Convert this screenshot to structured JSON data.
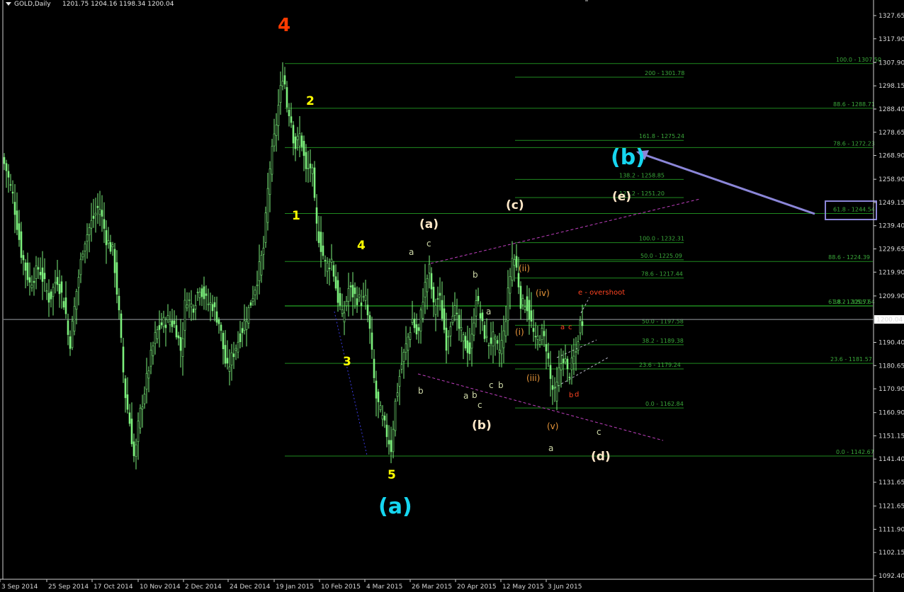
{
  "chart_data": {
    "type": "candlestick",
    "symbol_label": "GOLD,Daily",
    "ohlc_label": "1201.75 1204.16 1198.34 1200.04",
    "current_price": "1200.04",
    "y_range": [
      1092.65,
      1332.6
    ],
    "y_ticks": [
      "1327.65",
      "1317.90",
      "1307.90",
      "1298.15",
      "1288.40",
      "1278.65",
      "1268.90",
      "1258.90",
      "1249.15",
      "1239.40",
      "1229.65",
      "1219.90",
      "1209.90",
      "1190.40",
      "1180.65",
      "1170.90",
      "1160.90",
      "1151.15",
      "1141.40",
      "1131.65",
      "1121.65",
      "1111.90",
      "1102.15",
      "1092.40"
    ],
    "x_labels": [
      "3 Sep 2014",
      "25 Sep 2014",
      "17 Oct 2014",
      "10 Nov 2014",
      "2 Dec 2014",
      "24 Dec 2014",
      "19 Jan 2015",
      "10 Feb 2015",
      "4 Mar 2015",
      "26 Mar 2015",
      "20 Apr 2015",
      "12 May 2015",
      "3 Jun 2015"
    ],
    "price_path": [
      [
        0,
        1270
      ],
      [
        8,
        1264
      ],
      [
        18,
        1252
      ],
      [
        30,
        1228
      ],
      [
        42,
        1215
      ],
      [
        55,
        1222
      ],
      [
        70,
        1208
      ],
      [
        80,
        1218
      ],
      [
        92,
        1205
      ],
      [
        98,
        1188
      ],
      [
        108,
        1212
      ],
      [
        118,
        1232
      ],
      [
        128,
        1240
      ],
      [
        140,
        1248
      ],
      [
        150,
        1234
      ],
      [
        160,
        1228
      ],
      [
        168,
        1202
      ],
      [
        176,
        1170
      ],
      [
        184,
        1155
      ],
      [
        190,
        1140
      ],
      [
        196,
        1158
      ],
      [
        204,
        1170
      ],
      [
        212,
        1183
      ],
      [
        220,
        1194
      ],
      [
        228,
        1198
      ],
      [
        238,
        1200
      ],
      [
        248,
        1197
      ],
      [
        256,
        1186
      ],
      [
        262,
        1210
      ],
      [
        272,
        1205
      ],
      [
        282,
        1214
      ],
      [
        292,
        1207
      ],
      [
        300,
        1206
      ],
      [
        310,
        1198
      ],
      [
        320,
        1178
      ],
      [
        332,
        1188
      ],
      [
        342,
        1196
      ],
      [
        352,
        1205
      ],
      [
        362,
        1216
      ],
      [
        372,
        1230
      ],
      [
        380,
        1262
      ],
      [
        388,
        1278
      ],
      [
        394,
        1292
      ],
      [
        400,
        1305
      ],
      [
        405,
        1290
      ],
      [
        410,
        1286
      ],
      [
        416,
        1272
      ],
      [
        424,
        1278
      ],
      [
        432,
        1262
      ],
      [
        440,
        1265
      ],
      [
        446,
        1240
      ],
      [
        452,
        1232
      ],
      [
        460,
        1222
      ],
      [
        468,
        1225
      ],
      [
        476,
        1210
      ],
      [
        484,
        1200
      ],
      [
        492,
        1213
      ],
      [
        500,
        1210
      ],
      [
        508,
        1208
      ],
      [
        516,
        1208
      ],
      [
        522,
        1195
      ],
      [
        530,
        1168
      ],
      [
        538,
        1160
      ],
      [
        546,
        1152
      ],
      [
        552,
        1146
      ],
      [
        558,
        1165
      ],
      [
        566,
        1180
      ],
      [
        574,
        1190
      ],
      [
        582,
        1200
      ],
      [
        590,
        1192
      ],
      [
        598,
        1212
      ],
      [
        606,
        1221
      ],
      [
        612,
        1205
      ],
      [
        620,
        1210
      ],
      [
        630,
        1190
      ],
      [
        640,
        1206
      ],
      [
        648,
        1196
      ],
      [
        656,
        1190
      ],
      [
        664,
        1186
      ],
      [
        672,
        1210
      ],
      [
        680,
        1198
      ],
      [
        688,
        1190
      ],
      [
        696,
        1192
      ],
      [
        704,
        1186
      ],
      [
        712,
        1195
      ],
      [
        718,
        1214
      ],
      [
        724,
        1228
      ],
      [
        730,
        1220
      ],
      [
        736,
        1205
      ],
      [
        742,
        1208
      ],
      [
        750,
        1198
      ],
      [
        756,
        1190
      ],
      [
        764,
        1195
      ],
      [
        772,
        1188
      ],
      [
        778,
        1172
      ],
      [
        784,
        1168
      ],
      [
        790,
        1180
      ],
      [
        796,
        1185
      ],
      [
        802,
        1176
      ],
      [
        808,
        1182
      ],
      [
        814,
        1187
      ],
      [
        818,
        1198
      ],
      [
        822,
        1200
      ]
    ],
    "horizontal_levels": [
      {
        "label": "100.0 - 1307.50",
        "value": 1307.5
      },
      {
        "label": "200 - 1301.78",
        "value": 1301.78
      },
      {
        "label": "88.6 - 1288.71",
        "value": 1288.71
      },
      {
        "label": "161.8 - 1275.24",
        "value": 1275.24
      },
      {
        "label": "78.6 - 1272.23",
        "value": 1272.23
      },
      {
        "label": "138.2 - 1258.85",
        "value": 1258.85
      },
      {
        "label": "127.2 - 1251.20",
        "value": 1251.2
      },
      {
        "label": "61.8 - 1244.54",
        "value": 1244.54
      },
      {
        "label": "100.0 - 1232.31",
        "value": 1232.31
      },
      {
        "label": "88.6 - 1224.39",
        "value": 1224.39
      },
      {
        "label": "50.0 - 1225.09",
        "value": 1225.09
      },
      {
        "label": "78.6 - 1217.44",
        "value": 1217.44
      },
      {
        "label": "61.8 - 1205.77",
        "value": 1205.77
      },
      {
        "label": "38.2 - 1205.64",
        "value": 1205.64
      },
      {
        "label": "50.0 - 1197.58",
        "value": 1197.58
      },
      {
        "label": "38.2 - 1189.38",
        "value": 1189.38
      },
      {
        "label": "23.6 - 1181.57",
        "value": 1181.57
      },
      {
        "label": "23.6 - 1179.24",
        "value": 1179.24
      },
      {
        "label": "0.0 - 1162.84",
        "value": 1162.84
      },
      {
        "label": "0.0 - 1142.67",
        "value": 1142.67
      }
    ],
    "wave_labels": [
      {
        "text": "4",
        "color": "#ff3b00",
        "size": "large"
      },
      {
        "text": "2",
        "color": "#ffff00",
        "size": "medium"
      },
      {
        "text": "1",
        "color": "#ffff00",
        "size": "medium"
      },
      {
        "text": "4",
        "color": "#ffff00",
        "size": "medium"
      },
      {
        "text": "3",
        "color": "#ffff00",
        "size": "medium"
      },
      {
        "text": "5",
        "color": "#ffff00",
        "size": "medium"
      },
      {
        "text": "(a)",
        "color": "#16d6f0",
        "size": "xlarge"
      },
      {
        "text": "(b)",
        "color": "#16d6f0",
        "size": "xlarge"
      },
      {
        "text": "(a)",
        "color": "#ffe8c8",
        "size": "medium"
      },
      {
        "text": "(b)",
        "color": "#ffe8c8",
        "size": "medium"
      },
      {
        "text": "(c)",
        "color": "#ffe8c8",
        "size": "medium"
      },
      {
        "text": "(d)",
        "color": "#ffe8c8",
        "size": "medium"
      },
      {
        "text": "(e)",
        "color": "#ffe8c8",
        "size": "medium"
      },
      {
        "text": "a",
        "color": "#cfd9a8",
        "size": "small"
      },
      {
        "text": "c",
        "color": "#cfd9a8",
        "size": "small"
      },
      {
        "text": "b",
        "color": "#cfd9a8",
        "size": "small"
      },
      {
        "text": "a",
        "color": "#cfd9a8",
        "size": "small"
      },
      {
        "text": "b",
        "color": "#cfd9a8",
        "size": "small"
      },
      {
        "text": "c",
        "color": "#cfd9a8",
        "size": "small"
      },
      {
        "text": "a",
        "color": "#cfd9a8",
        "size": "small"
      },
      {
        "text": "b",
        "color": "#cfd9a8",
        "size": "small"
      },
      {
        "text": "c",
        "color": "#cfd9a8",
        "size": "small"
      },
      {
        "text": "b",
        "color": "#cfd9a8",
        "size": "small"
      },
      {
        "text": "a",
        "color": "#cfd9a8",
        "size": "small"
      },
      {
        "text": "c",
        "color": "#cfd9a8",
        "size": "small"
      },
      {
        "text": "(i)",
        "color": "#e8963a",
        "size": "small"
      },
      {
        "text": "(ii)",
        "color": "#e8963a",
        "size": "small"
      },
      {
        "text": "(iii)",
        "color": "#e8963a",
        "size": "small"
      },
      {
        "text": "(iv)",
        "color": "#e8963a",
        "size": "small"
      },
      {
        "text": "(v)",
        "color": "#e8963a",
        "size": "small"
      },
      {
        "text": "a",
        "color": "#ff4422",
        "size": "tiny"
      },
      {
        "text": "c",
        "color": "#ff4422",
        "size": "tiny"
      },
      {
        "text": "b",
        "color": "#ff4422",
        "size": "tiny"
      },
      {
        "text": "d",
        "color": "#ff4422",
        "size": "tiny"
      },
      {
        "text": "e - overshoot",
        "color": "#ff4422",
        "size": "tiny"
      }
    ],
    "colors": {
      "background": "#000000",
      "candles": "#7cf07c",
      "fib_lines": "#1f8a1f",
      "trend_lines": "#c040c0",
      "arrow": "#8b86d8",
      "price_line": "#9aa0a6"
    }
  }
}
